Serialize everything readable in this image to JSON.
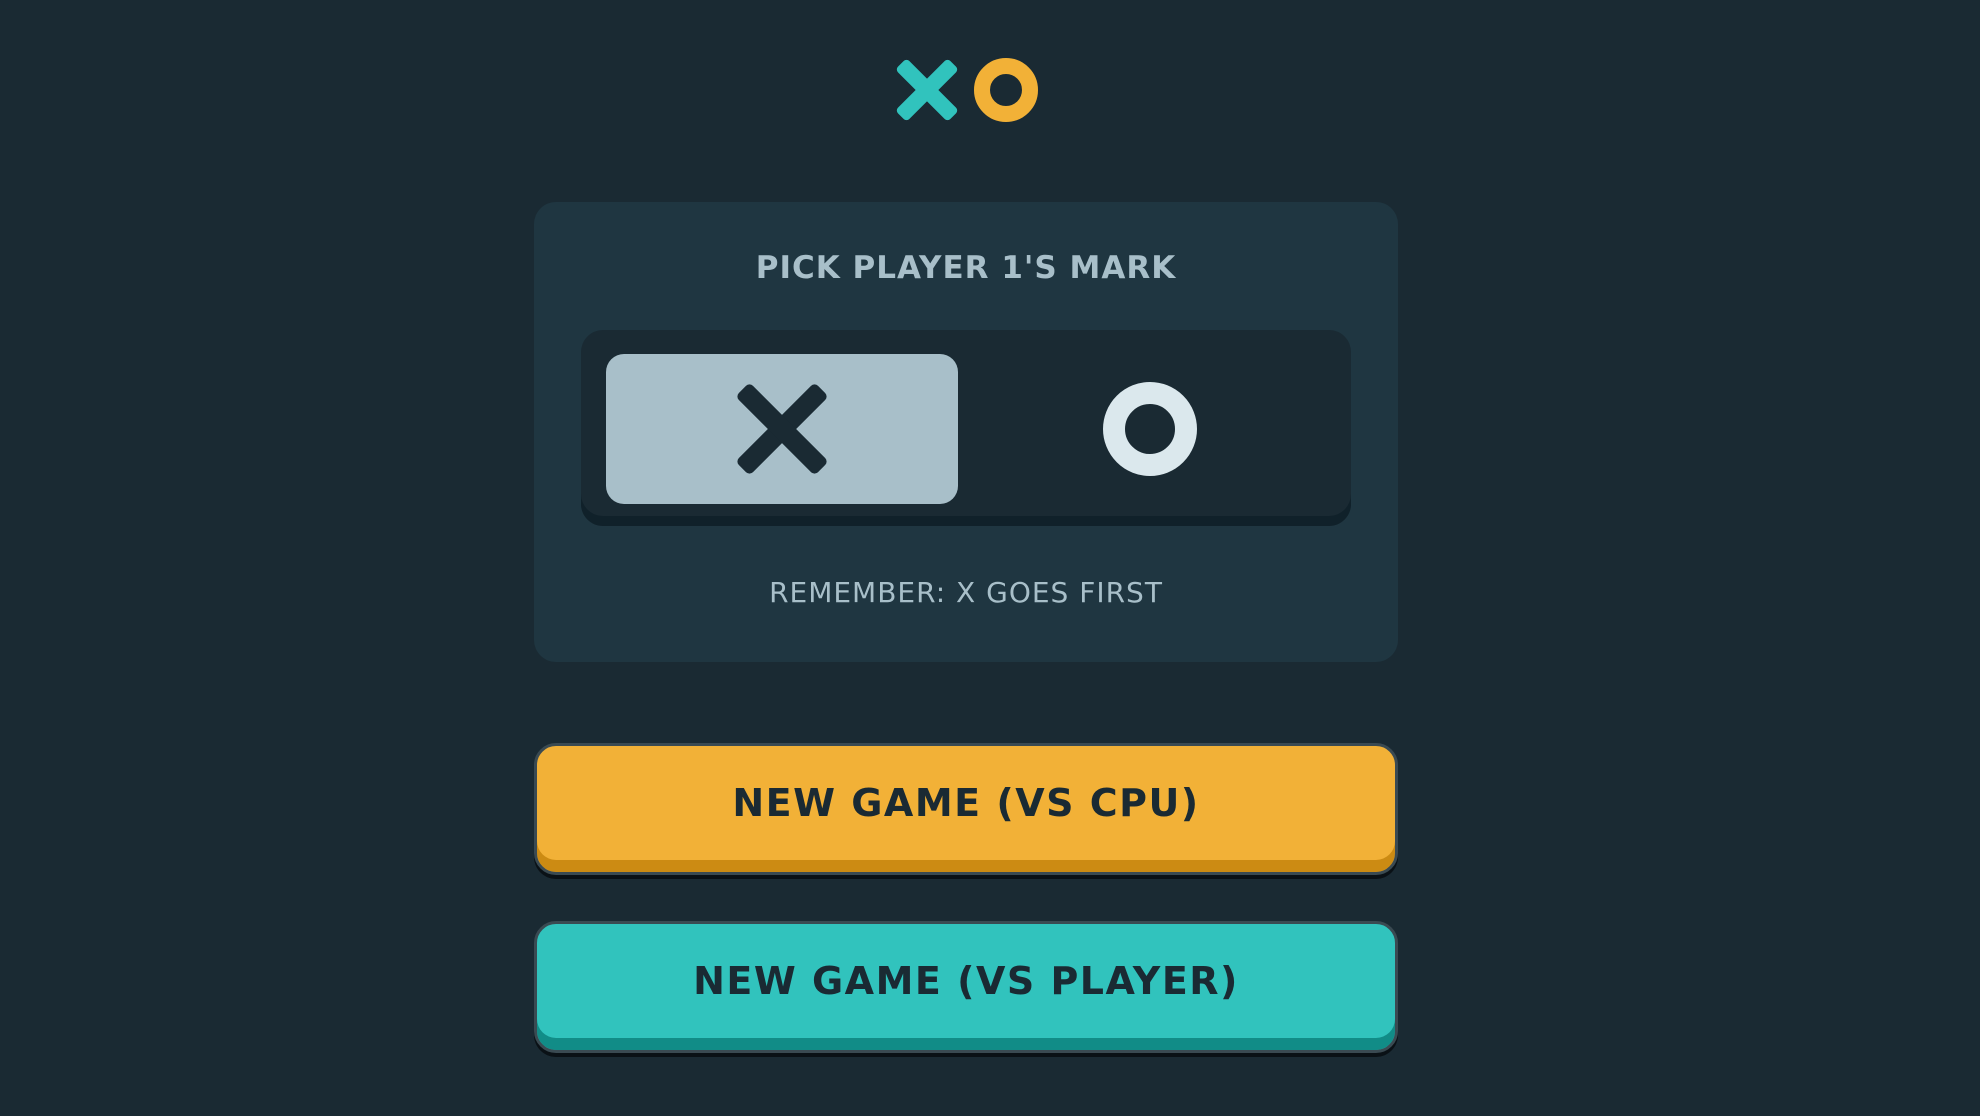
{
  "logo": {
    "x_icon": "x-mark-icon",
    "o_icon": "o-mark-icon",
    "x_color": "#31C3BD",
    "o_color": "#F2B137"
  },
  "mark_picker": {
    "title": "PICK PLAYER 1'S MARK",
    "options": [
      {
        "mark": "X",
        "icon": "x-mark-icon",
        "selected": true
      },
      {
        "mark": "O",
        "icon": "o-mark-icon",
        "selected": false
      }
    ],
    "note": "REMEMBER: X GOES FIRST"
  },
  "buttons": {
    "vs_cpu": "NEW GAME (VS CPU)",
    "vs_player": "NEW GAME (VS PLAYER)"
  },
  "colors": {
    "background": "#1A2A33",
    "panel": "#1F3641",
    "silver": "#A8BFC9",
    "yellow": "#F2B137",
    "teal": "#31C3BD"
  }
}
